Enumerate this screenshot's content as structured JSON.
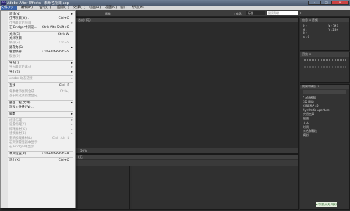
{
  "app": {
    "title": "Adobe After Effects - 未命名项目.aep",
    "logo": "Ae"
  },
  "window_controls": {
    "minimize": "–",
    "maximize": "□",
    "close": "×"
  },
  "menubar": {
    "items": [
      "文件(F)",
      "编辑(E)",
      "合成(C)",
      "图层(L)",
      "效果(T)",
      "动画(A)",
      "视图(V)",
      "窗口",
      "帮助(H)"
    ],
    "selected": 0
  },
  "toolbar": {
    "workspace_label": "工作区:",
    "workspace_value": "标准",
    "search_placeholder": "搜索帮助"
  },
  "file_menu": {
    "items": [
      {
        "label": "新建(N)",
        "shortcut": "",
        "arrow": true,
        "disabled": false
      },
      {
        "label": "打开项目(O)...",
        "shortcut": "Ctrl+O",
        "arrow": false,
        "disabled": false
      },
      {
        "label": "打开最近的项目",
        "shortcut": "",
        "arrow": true,
        "disabled": true
      },
      {
        "label": "在 Bridge 中浏览...",
        "shortcut": "Ctrl+Alt+Shift+O",
        "arrow": false,
        "disabled": false
      },
      {
        "sep": true
      },
      {
        "label": "关闭(C)",
        "shortcut": "Ctrl+W",
        "arrow": false,
        "disabled": false
      },
      {
        "label": "关闭项目",
        "shortcut": "",
        "arrow": false,
        "disabled": false
      },
      {
        "label": "保存(S)",
        "shortcut": "Ctrl+S",
        "arrow": false,
        "disabled": true
      },
      {
        "label": "另存为(S)",
        "shortcut": "",
        "arrow": true,
        "disabled": false
      },
      {
        "label": "增量保存",
        "shortcut": "Ctrl+Alt+Shift+S",
        "arrow": false,
        "disabled": false
      },
      {
        "label": "恢复(R)",
        "shortcut": "",
        "arrow": false,
        "disabled": true
      },
      {
        "sep": true
      },
      {
        "label": "导入(I)",
        "shortcut": "",
        "arrow": true,
        "disabled": false
      },
      {
        "label": "导入最近的素材",
        "shortcut": "",
        "arrow": true,
        "disabled": true
      },
      {
        "label": "导出(E)",
        "shortcut": "",
        "arrow": true,
        "disabled": false
      },
      {
        "sep": true
      },
      {
        "label": "Adobe 动态链接",
        "shortcut": "",
        "arrow": true,
        "disabled": true
      },
      {
        "sep": true
      },
      {
        "label": "查找",
        "shortcut": "Ctrl+F",
        "arrow": false,
        "disabled": false
      },
      {
        "sep": true
      },
      {
        "label": "将素材添加到合成",
        "shortcut": "Ctrl+/",
        "arrow": false,
        "disabled": true
      },
      {
        "label": "基于所选项新建合成",
        "shortcut": "",
        "arrow": false,
        "disabled": true
      },
      {
        "sep": true
      },
      {
        "label": "整理工程(文件)",
        "shortcut": "",
        "arrow": true,
        "disabled": false
      },
      {
        "label": "监视文件夹(W)...",
        "shortcut": "",
        "arrow": false,
        "disabled": false
      },
      {
        "sep": true
      },
      {
        "label": "脚本",
        "shortcut": "",
        "arrow": true,
        "disabled": false
      },
      {
        "sep": true
      },
      {
        "label": "创建代理",
        "shortcut": "",
        "arrow": true,
        "disabled": true
      },
      {
        "label": "设置代理(Y)",
        "shortcut": "",
        "arrow": true,
        "disabled": true
      },
      {
        "label": "解释素材(G)",
        "shortcut": "",
        "arrow": true,
        "disabled": true
      },
      {
        "label": "替换素材(E)",
        "shortcut": "",
        "arrow": true,
        "disabled": true
      },
      {
        "label": "重新加载素材(L)",
        "shortcut": "Ctrl+Alt+L",
        "arrow": false,
        "disabled": true
      },
      {
        "label": "在资源管理器中显示",
        "shortcut": "",
        "arrow": false,
        "disabled": true
      },
      {
        "label": "在 Bridge 中显示",
        "shortcut": "",
        "arrow": false,
        "disabled": true
      },
      {
        "sep": true
      },
      {
        "label": "项目设置(P)...",
        "shortcut": "Ctrl+Alt+Shift+K",
        "arrow": false,
        "disabled": false
      },
      {
        "sep": true
      },
      {
        "label": "退出(X)",
        "shortcut": "Ctrl+Q",
        "arrow": false,
        "disabled": false
      }
    ]
  },
  "comp_panel": {
    "title": "合成: (无)",
    "zoom": "50%"
  },
  "info_panel": {
    "title": "信息 × 音频",
    "r": "R :",
    "g": "G :",
    "b": "B :",
    "a": "A : 0",
    "x": "X : 346",
    "y": "Y : 289"
  },
  "preview_panel": {
    "title": "预览 ×"
  },
  "effects_panel": {
    "title": "效果和预设 ×",
    "categories": [
      "* 动画预设",
      "3D 通道",
      "CINEMA 4D",
      "Synthetic Aperture",
      "实用工具",
      "扭曲",
      "文本",
      "时间",
      "杂色和颗粒",
      "模拟"
    ]
  },
  "timeline": {
    "title": "(无)"
  },
  "render_button": {
    "label": "▸ 切换开关 / 模式"
  },
  "colors": {
    "accent": "#3a62a8",
    "menubg": "#f0f0f0",
    "panel": "#333333"
  }
}
